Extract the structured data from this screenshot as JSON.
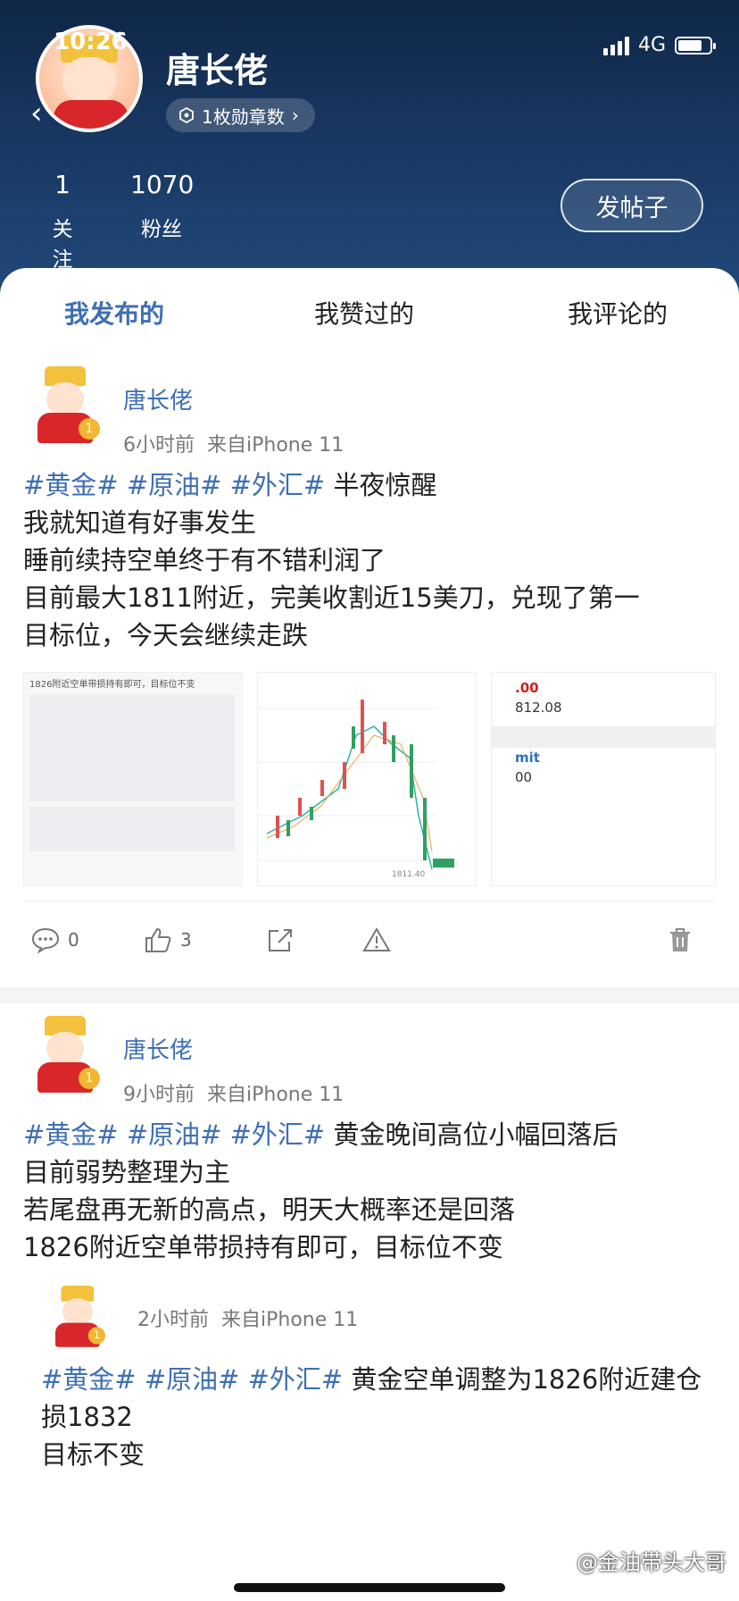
{
  "status_bar": {
    "time": "10:26",
    "network": "4G"
  },
  "profile": {
    "name": "唐长佬",
    "badge_text": "1枚勋章数",
    "following_count": "1",
    "following_label": "关注",
    "followers_count": "1070",
    "followers_label": "粉丝",
    "post_button": "发帖子"
  },
  "tabs": [
    {
      "label": "我发布的",
      "active": true
    },
    {
      "label": "我赞过的",
      "active": false
    },
    {
      "label": "我评论的",
      "active": false
    }
  ],
  "posts": [
    {
      "author": "唐长佬",
      "time": "6小时前",
      "source": "来自iPhone 11",
      "tags": "#黄金# #原油# #外汇#",
      "lines": [
        "半夜惊醒",
        "我就知道有好事发生",
        "睡前续持空单终于有不错利润了",
        "目前最大1811附近，完美收割近15美刀，兑现了第一",
        "目标位，今天会继续走跌"
      ],
      "image_texts": {
        "img1_caption": "1826附近空单带损持有即可，目标位不变",
        "img2_price": "1811.40",
        "img3_a": ".00",
        "img3_b": "812.08",
        "img3_c": "mit",
        "img3_d": "00"
      },
      "comments": "0",
      "likes": "3"
    },
    {
      "author": "唐长佬",
      "time": "9小时前",
      "source": "来自iPhone 11",
      "tags": "#黄金# #原油# #外汇#",
      "lines": [
        "黄金晚间高位小幅回落后",
        "目前弱势整理为主",
        "若尾盘再无新的高点，明天大概率还是回落",
        "1826附近空单带损持有即可，目标位不变"
      ],
      "quote": {
        "time": "2小时前",
        "source": "来自iPhone 11",
        "tags": "#黄金# #原油# #外汇#",
        "line1": "黄金空单调整为1826附近建仓",
        "line2": "损1832",
        "line3": "目标不变"
      }
    }
  ],
  "watermark": "@金油带头大哥",
  "colors": {
    "accent": "#3f6fb5",
    "header": "#1a3a66"
  }
}
